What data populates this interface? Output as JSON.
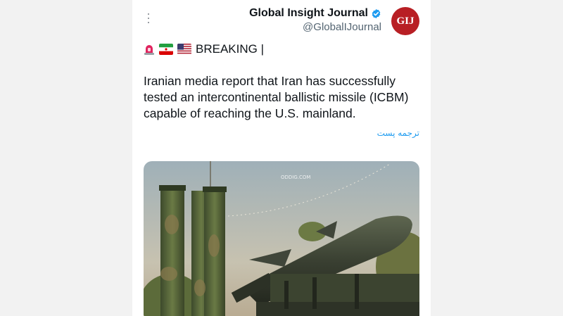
{
  "post": {
    "author_name": "Global Insight Journal",
    "handle": "@GlobalIJournal",
    "avatar_text": "GIJ",
    "breaking_label": "BREAKING |",
    "text": "Iranian media report that Iran has successfully tested an intercontinental ballistic missile (ICBM) capable of reaching the U.S. mainland.",
    "translate_label": "ترجمه پست",
    "watermark": "ODDIG.COM"
  },
  "icons": [
    "more-icon",
    "verified-badge-icon",
    "siren-icon",
    "iran-flag-icon",
    "us-flag-icon"
  ],
  "colors": {
    "avatar": "#b81f24",
    "verified": "#1d9bf0",
    "link": "#1d9bf0",
    "text": "#0f1419",
    "secondary": "#536471"
  }
}
